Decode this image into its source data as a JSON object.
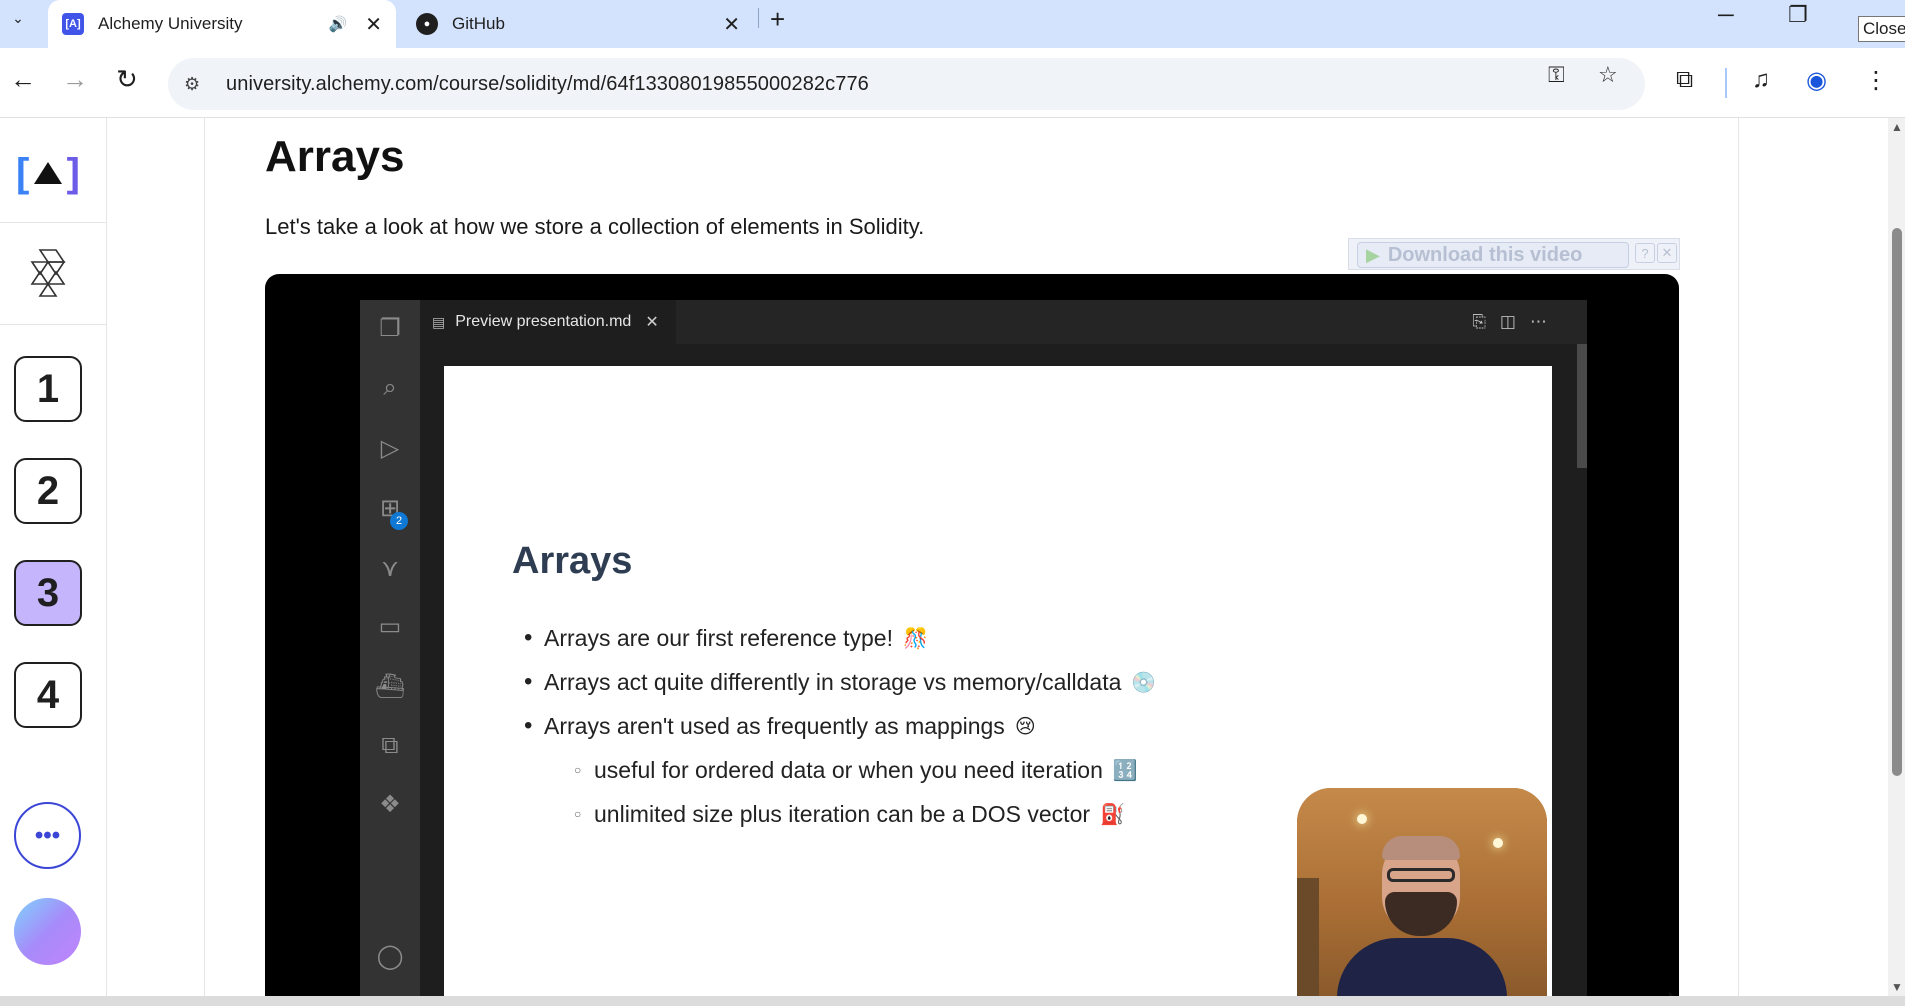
{
  "browser": {
    "tabs": [
      {
        "title": "Alchemy University",
        "favicon": "[A]",
        "active": true,
        "audio": true
      },
      {
        "title": "GitHub",
        "favicon": "gh",
        "active": false
      }
    ],
    "new_tab_icon": "+",
    "close_tooltip": "Close",
    "url": "university.alchemy.com/course/solidity/md/64f13308019855000282c776"
  },
  "sidebar": {
    "logo_left": "[",
    "logo_right": "]",
    "steps": [
      {
        "label": "1",
        "current": false
      },
      {
        "label": "2",
        "current": false
      },
      {
        "label": "3",
        "current": true
      },
      {
        "label": "4",
        "current": false
      }
    ],
    "more_label": "•••"
  },
  "lesson": {
    "title": "Arrays",
    "subtitle": "Let's take a look at how we store a collection of elements in Solidity."
  },
  "download": {
    "label": "Download this video",
    "help": "?",
    "close": "✕"
  },
  "video": {
    "editor_tab": "Preview presentation.md",
    "extensions_badge": "2",
    "slide": {
      "title": "Arrays",
      "bullets": [
        {
          "text": "Arrays are our first reference type!",
          "emoji": "🎊"
        },
        {
          "text": "Arrays act quite differently in storage vs memory/calldata",
          "emoji": "💿"
        },
        {
          "text": "Arrays aren't used as frequently as mappings",
          "emoji": "😢"
        }
      ],
      "sub_bullets": [
        {
          "text": "useful for ordered data or when you need iteration",
          "emoji": "🔢"
        },
        {
          "text": "unlimited size plus iteration can be a DOS vector",
          "emoji": "⛽"
        }
      ]
    }
  },
  "colors": {
    "tabstrip": "#d3e3fd",
    "current_step": "#c4b5fd",
    "accent": "#3b46d6"
  }
}
